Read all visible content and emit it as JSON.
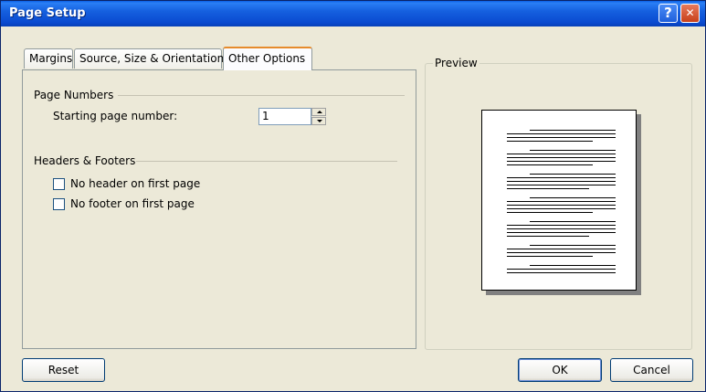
{
  "window": {
    "title": "Page Setup",
    "help_glyph": "?",
    "close_glyph": "✕"
  },
  "tabs": [
    {
      "label": "Margins"
    },
    {
      "label": "Source, Size & Orientation"
    },
    {
      "label": "Other Options",
      "active": true
    }
  ],
  "page_numbers": {
    "title": "Page Numbers",
    "starting_label": "Starting page number:",
    "starting_value": "1"
  },
  "headers_footers": {
    "title": "Headers & Footers",
    "no_header_label": "No header on first page",
    "no_header_checked": false,
    "no_footer_label": "No footer on first page",
    "no_footer_checked": false
  },
  "preview": {
    "title": "Preview"
  },
  "buttons": {
    "reset": "Reset",
    "ok": "OK",
    "cancel": "Cancel"
  },
  "colors": {
    "dialog_bg": "#ece9d8",
    "titlebar": "#0a4ad0",
    "active_tab_accent": "#e68b2c"
  },
  "icons": [
    "help-icon",
    "close-icon",
    "spin-up-arrow-icon",
    "spin-down-arrow-icon",
    "page-preview-icon"
  ]
}
